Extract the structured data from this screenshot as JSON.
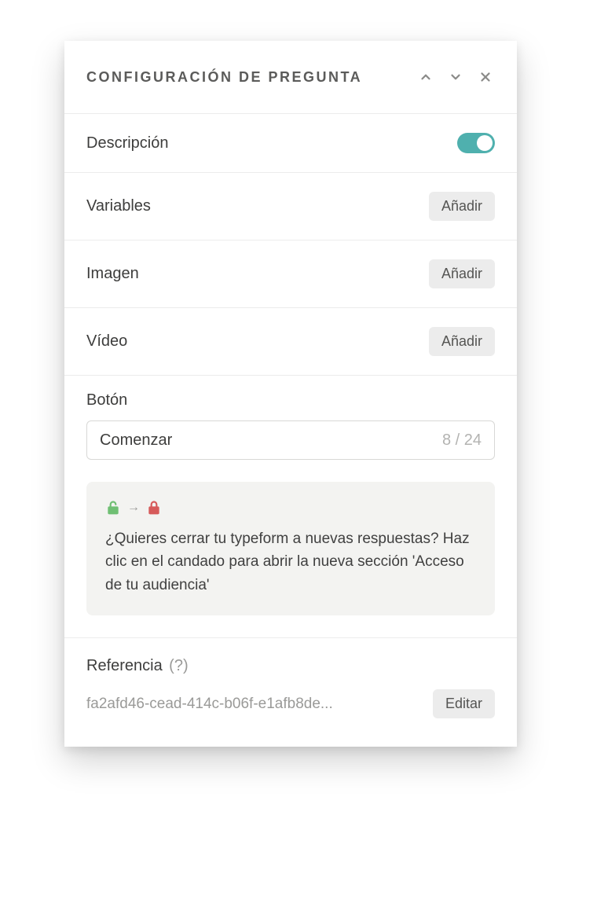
{
  "header": {
    "title": "CONFIGURACIÓN DE PREGUNTA"
  },
  "rows": {
    "description": {
      "label": "Descripción",
      "toggle_on": true
    },
    "variables": {
      "label": "Variables",
      "action": "Añadir"
    },
    "image": {
      "label": "Imagen",
      "action": "Añadir"
    },
    "video": {
      "label": "Vídeo",
      "action": "Añadir"
    }
  },
  "button_field": {
    "label": "Botón",
    "value": "Comenzar",
    "counter": "8 / 24"
  },
  "info_card": {
    "text": "¿Quieres cerrar tu typeform a nuevas respuestas? Haz clic en el candado para abrir la nueva sección 'Acceso de tu audiencia'"
  },
  "reference": {
    "label": "Referencia",
    "help": "(?)",
    "value": "fa2afd46-cead-414c-b06f-e1afb8de...",
    "action": "Editar"
  }
}
